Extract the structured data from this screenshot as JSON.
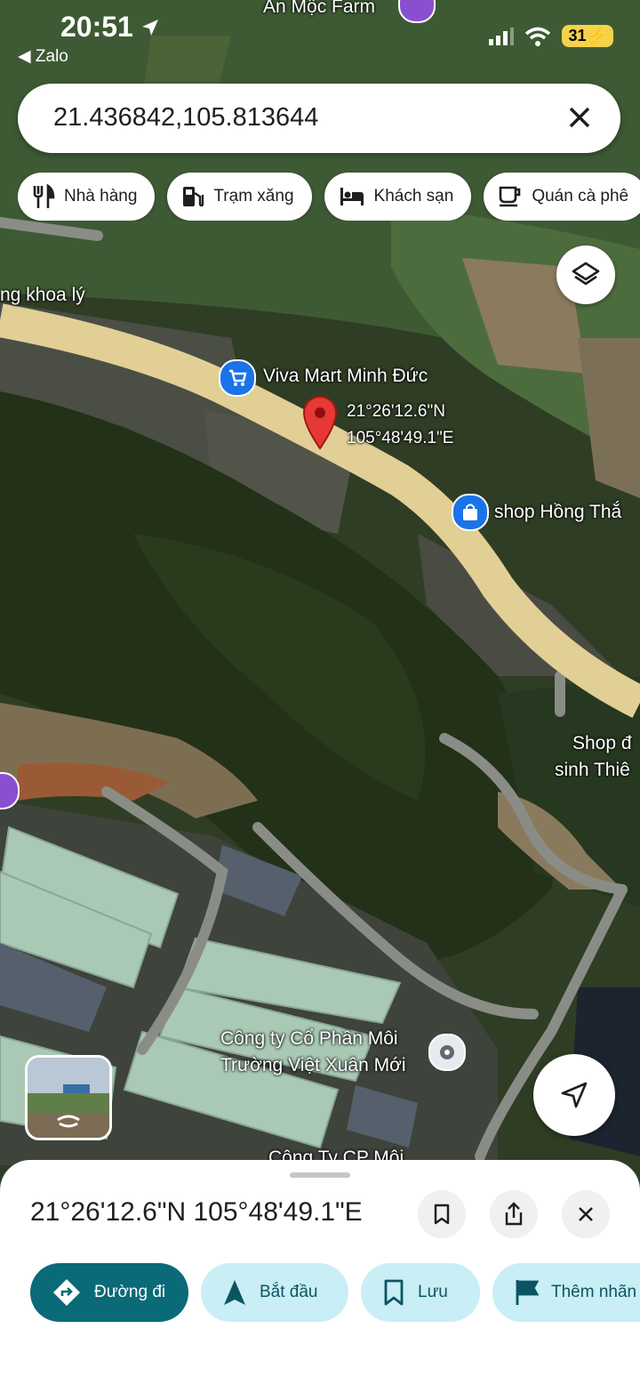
{
  "status_bar": {
    "time": "20:51",
    "back_app": "◀ Zalo",
    "battery": "31"
  },
  "search": {
    "value": "21.436842,105.813644"
  },
  "chips": [
    {
      "label": "Nhà hàng",
      "icon": "restaurant-icon"
    },
    {
      "label": "Trạm xăng",
      "icon": "gas-station-icon"
    },
    {
      "label": "Khách sạn",
      "icon": "hotel-icon"
    },
    {
      "label": "Quán cà phê",
      "icon": "cafe-icon"
    }
  ],
  "map_labels": {
    "farm": "An Mộc Farm",
    "khoa_ly": "ng khoa lý",
    "viva": "Viva Mart Minh Đức",
    "pin_lat": "21°26'12.6\"N",
    "pin_lng": "105°48'49.1\"E",
    "shop_hong": "shop Hồng Thắ",
    "shop_d_1": "Shop đ",
    "shop_d_2": "sinh Thiê",
    "company_1": "Công ty Cổ Phần Môi",
    "company_2": "Trường Việt Xuân Mới",
    "company_3": "Công Ty CP Môi"
  },
  "sheet": {
    "coordinates": "21°26'12.6\"N 105°48'49.1\"E",
    "actions": [
      {
        "label": "Đường đi",
        "icon": "directions-icon"
      },
      {
        "label": "Bắt đầu",
        "icon": "navigation-icon"
      },
      {
        "label": "Lưu",
        "icon": "bookmark-icon"
      },
      {
        "label": "Thêm nhãn",
        "icon": "flag-icon"
      }
    ]
  },
  "colors": {
    "accent": "#0b6a78",
    "pin": "#e53935",
    "road": "#e2cf95"
  }
}
